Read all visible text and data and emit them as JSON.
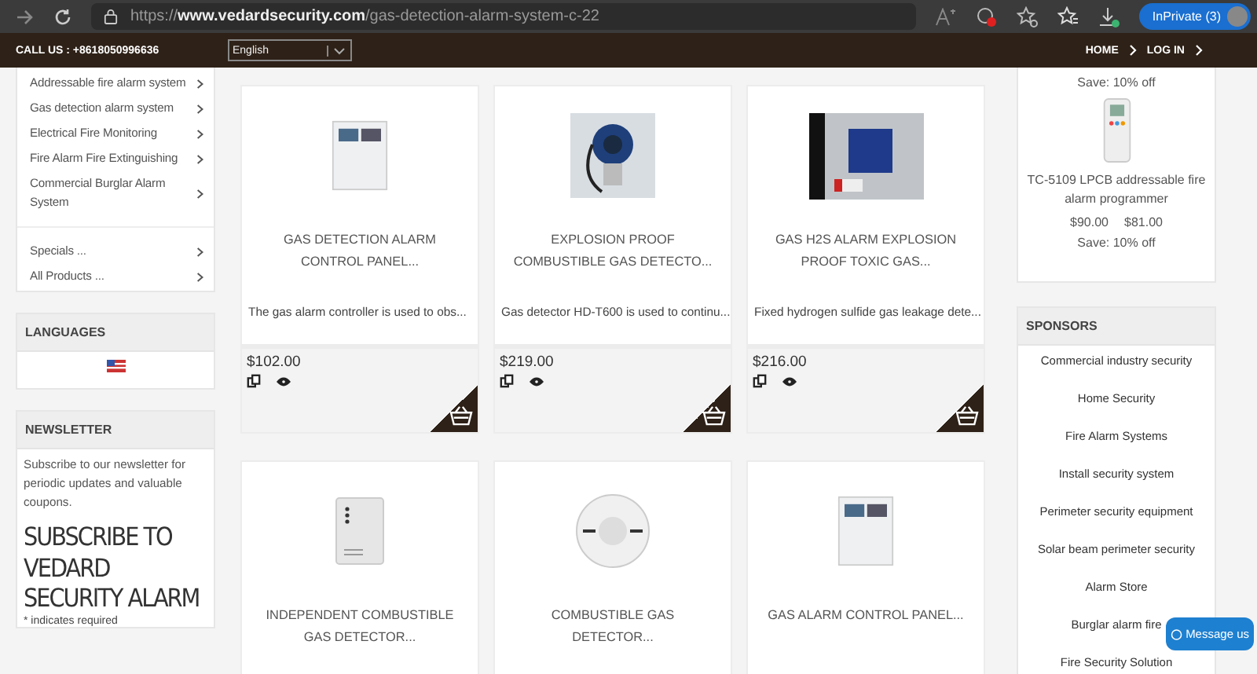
{
  "browser": {
    "url": "https://**www.vedardsecurity.com**/gas-detection-alarm-system-c-22",
    "profile": "InPrivate (3)"
  },
  "topbar": {
    "call": "CALL US : +8618050996636",
    "language": "English",
    "nav": [
      "HOME",
      "LOG IN"
    ]
  },
  "categories": [
    "Addressable fire alarm system",
    "Gas detection alarm system",
    "Electrical Fire Monitoring",
    "Fire Alarm Fire Extinguishing",
    "Commercial Burglar Alarm System"
  ],
  "more_links": [
    "Specials ...",
    "All Products ..."
  ],
  "languages": {
    "title": "LANGUAGES"
  },
  "newsletter": {
    "title": "NEWSLETTER",
    "text": "Subscribe to our newsletter for periodic updates and valuable coupons.",
    "heading": "SUBSCRIBE TO VEDARD SECURITY ALARM",
    "required": "* indicates required"
  },
  "products": [
    {
      "kind": "panel",
      "name": "GAS DETECTION ALARM CONTROL PANEL...",
      "description": "The gas alarm controller is used to obs...",
      "price": "$102.00"
    },
    {
      "kind": "detector",
      "name": "EXPLOSION PROOF COMBUSTIBLE GAS DETECTO...",
      "description": "Gas detector HD-T600 is used to continu...",
      "price": "$219.00"
    },
    {
      "kind": "box",
      "name": "GAS H2S ALARM EXPLOSION PROOF TOXIC GAS...",
      "description": "Fixed hydrogen sulfide gas leakage dete...",
      "price": "$216.00"
    },
    {
      "kind": "wall",
      "name": "INDEPENDENT COMBUSTIBLE GAS DETECTOR..."
    },
    {
      "kind": "smoke",
      "name": "COMBUSTIBLE GAS DETECTOR..."
    },
    {
      "kind": "panel",
      "name": "GAS ALARM CONTROL PANEL..."
    }
  ],
  "special": {
    "save_top": "Save: 10% off",
    "name": "TC-5109 LPCB addressable fire alarm programmer",
    "old_price": "$90.00",
    "price": "$81.00",
    "save_bottom": "Save: 10% off"
  },
  "sponsors": {
    "title": "SPONSORS",
    "items": [
      "Commercial industry security",
      "Home Security",
      "Fire Alarm Systems",
      "Install security system",
      "Perimeter security equipment",
      "Solar beam perimeter security",
      "Alarm Store",
      "Burglar alarm fire",
      "Fire Security Solution"
    ]
  },
  "chat": {
    "label": "Message us"
  }
}
